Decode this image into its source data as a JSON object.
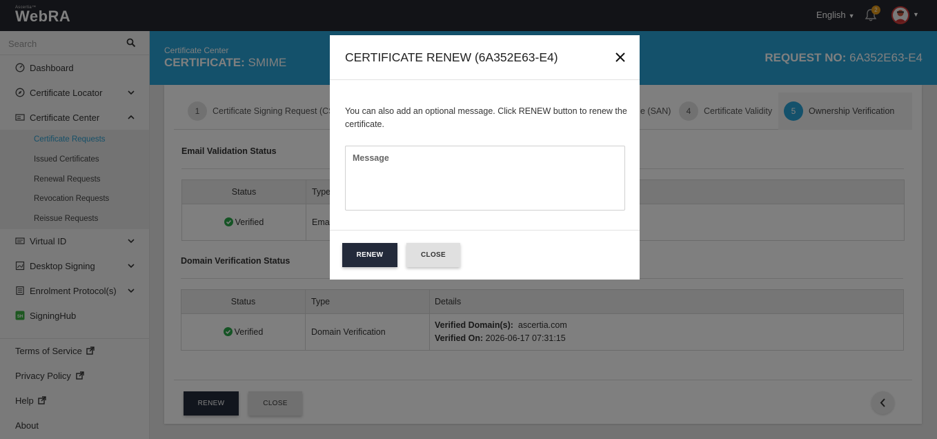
{
  "topbar": {
    "logo_small": "Ascertia™",
    "logo_main": "WebRA",
    "language": "English",
    "notifications_count": "2"
  },
  "sidebar": {
    "search_placeholder": "Search",
    "items": [
      {
        "label": "Dashboard"
      },
      {
        "label": "Certificate Locator"
      },
      {
        "label": "Certificate Center"
      },
      {
        "label": "Virtual ID"
      },
      {
        "label": "Desktop Signing"
      },
      {
        "label": "Enrolment Protocol(s)"
      },
      {
        "label": "SigningHub"
      }
    ],
    "submenu": [
      {
        "label": "Certificate Requests",
        "active": true
      },
      {
        "label": "Issued Certificates"
      },
      {
        "label": "Renewal Requests"
      },
      {
        "label": "Revocation Requests"
      },
      {
        "label": "Reissue Requests"
      }
    ],
    "footer": [
      {
        "label": "Terms of Service"
      },
      {
        "label": "Privacy Policy"
      },
      {
        "label": "Help"
      },
      {
        "label": "About"
      }
    ]
  },
  "header": {
    "breadcrumb": "Certificate Center",
    "title_bold": "CERTIFICATE:",
    "title_value": "SMIME",
    "request_label": "REQUEST NO:",
    "request_value": "6A352E63-E4"
  },
  "steps": [
    {
      "num": "1",
      "label": "Certificate Signing Request (CS"
    },
    {
      "num": "",
      "label": "e (SAN)"
    },
    {
      "num": "4",
      "label": "Certificate Validity"
    },
    {
      "num": "5",
      "label": "Ownership Verification",
      "active": true
    }
  ],
  "email_section": {
    "title": "Email Validation Status",
    "headers": [
      "Status",
      "Type"
    ],
    "row": {
      "status": "Verified",
      "type": "Emai"
    }
  },
  "domain_section": {
    "title": "Domain Verification Status",
    "headers": [
      "Status",
      "Type",
      "Details"
    ],
    "row": {
      "status": "Verified",
      "type": "Domain Verification",
      "detail1_label": "Verified Domain(s):",
      "detail1_value": "ascertia.com",
      "detail2_label": "Verified On:",
      "detail2_value": "2026-06-17 07:31:15"
    }
  },
  "page_buttons": {
    "renew": "RENEW",
    "close": "CLOSE"
  },
  "modal": {
    "title": "CERTIFICATE RENEW (6A352E63-E4)",
    "text": "You can also add an optional message. Click RENEW button to renew the certificate.",
    "message_placeholder": "Message",
    "renew": "RENEW",
    "close": "CLOSE"
  }
}
